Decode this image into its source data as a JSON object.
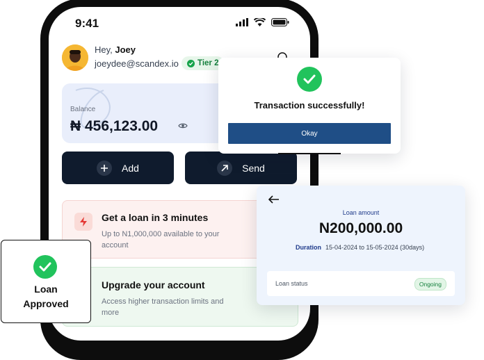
{
  "status_bar": {
    "time": "9:41"
  },
  "profile": {
    "greeting": "Hey,",
    "name": "Joey",
    "email": "joeydee@scandex.io",
    "tier": "Tier 2"
  },
  "balance": {
    "label": "Balance",
    "amount": "₦ 456,123.00"
  },
  "actions": {
    "add_label": "Add",
    "send_label": "Send"
  },
  "loan_card": {
    "title": "Get a loan in 3 minutes",
    "subtitle": "Up to N1,000,000 available to your account"
  },
  "upgrade_card": {
    "title": "Upgrade your account",
    "subtitle": "Access higher transaction limits and more"
  },
  "success_popup": {
    "message": "Transaction successfully!",
    "button_label": "Okay"
  },
  "loan_detail": {
    "amount_label": "Loan amount",
    "amount": "N200,000.00",
    "duration_label": "Duration",
    "duration_value": "15-04-2024 to 15-05-2024 (30days)",
    "status_label": "Loan status",
    "status_value": "Ongoing"
  },
  "approved_badge": {
    "line1": "Loan",
    "line2": "Approved"
  },
  "colors": {
    "primary_dark": "#0f1b2d",
    "success_green": "#21c35c",
    "button_blue": "#1f4e86",
    "loan_card_bg": "#fdf1f0",
    "upgrade_card_bg": "#eef8f0",
    "balance_card_bg": "#e9eefb"
  }
}
